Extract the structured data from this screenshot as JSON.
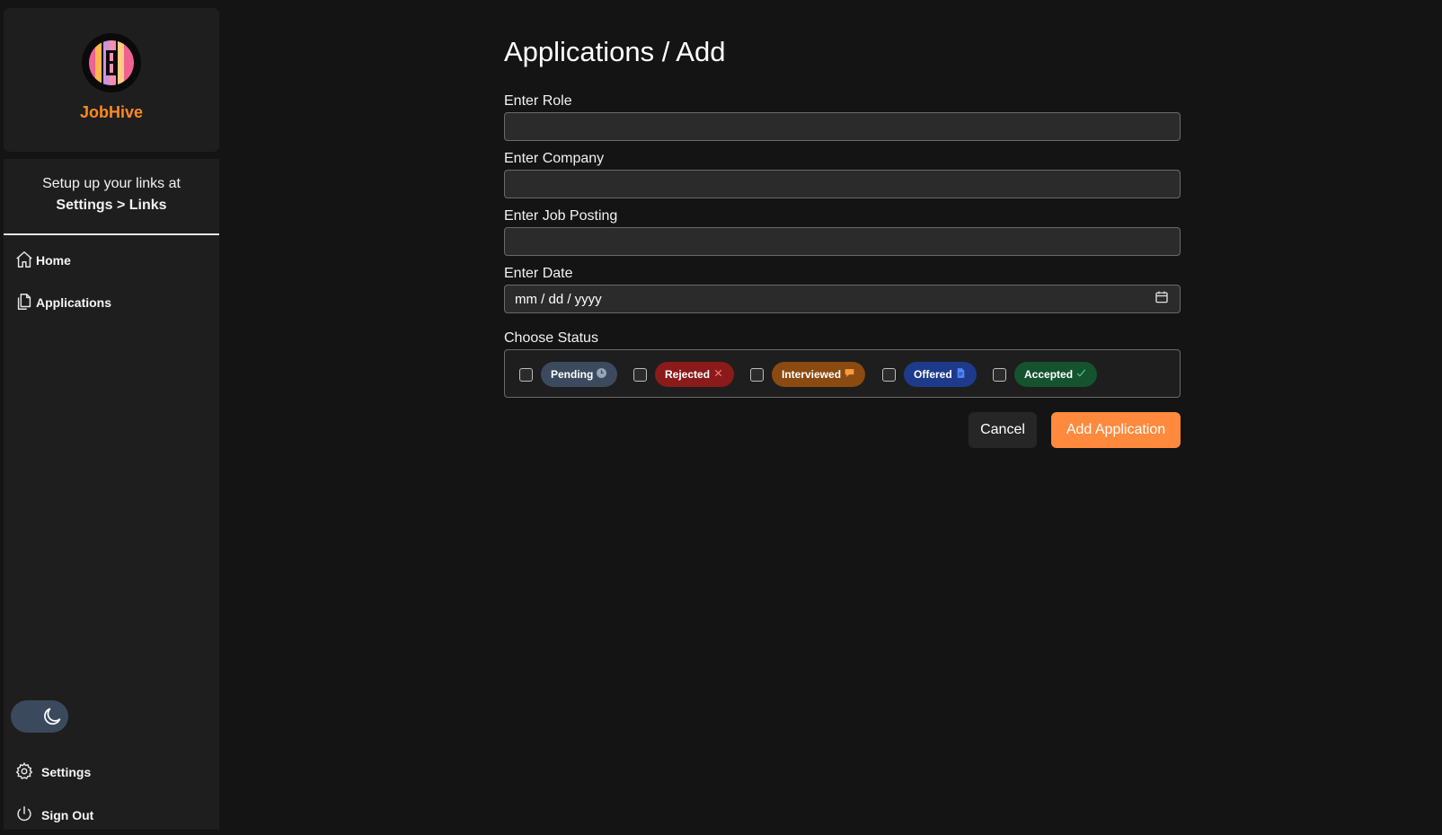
{
  "sidebar": {
    "brand_name": "JobHive",
    "links_hint_line1": "Setup up your links at",
    "links_hint_line2": "Settings > Links",
    "nav": [
      {
        "label": "Home",
        "icon": "home-icon"
      },
      {
        "label": "Applications",
        "icon": "documents-icon"
      }
    ],
    "theme_toggle_icon": "moon-icon",
    "settings_label": "Settings",
    "signout_label": "Sign Out"
  },
  "main": {
    "title": "Applications / Add",
    "fields": {
      "role_label": "Enter Role",
      "role_value": "",
      "company_label": "Enter Company",
      "company_value": "",
      "posting_label": "Enter Job Posting",
      "posting_value": "",
      "date_label": "Enter Date",
      "date_placeholder": "mm / dd / yyyy"
    },
    "status_label": "Choose Status",
    "statuses": [
      {
        "label": "Pending",
        "icon": "clock-icon",
        "color": "#3c4a5e",
        "checked": false
      },
      {
        "label": "Rejected",
        "icon": "x-icon",
        "color": "#8b1a1a",
        "checked": false
      },
      {
        "label": "Interviewed",
        "icon": "speech-bubble-icon",
        "color": "#8a4a10",
        "checked": false
      },
      {
        "label": "Offered",
        "icon": "document-icon",
        "color": "#1e3a8a",
        "checked": false
      },
      {
        "label": "Accepted",
        "icon": "checkmark-icon",
        "color": "#14532d",
        "checked": false
      }
    ],
    "cancel_label": "Cancel",
    "submit_label": "Add Application"
  },
  "colors": {
    "accent": "#ff8a3d",
    "brand": "#ff8a1f",
    "background": "#141414",
    "panel": "#1e1e1e"
  }
}
